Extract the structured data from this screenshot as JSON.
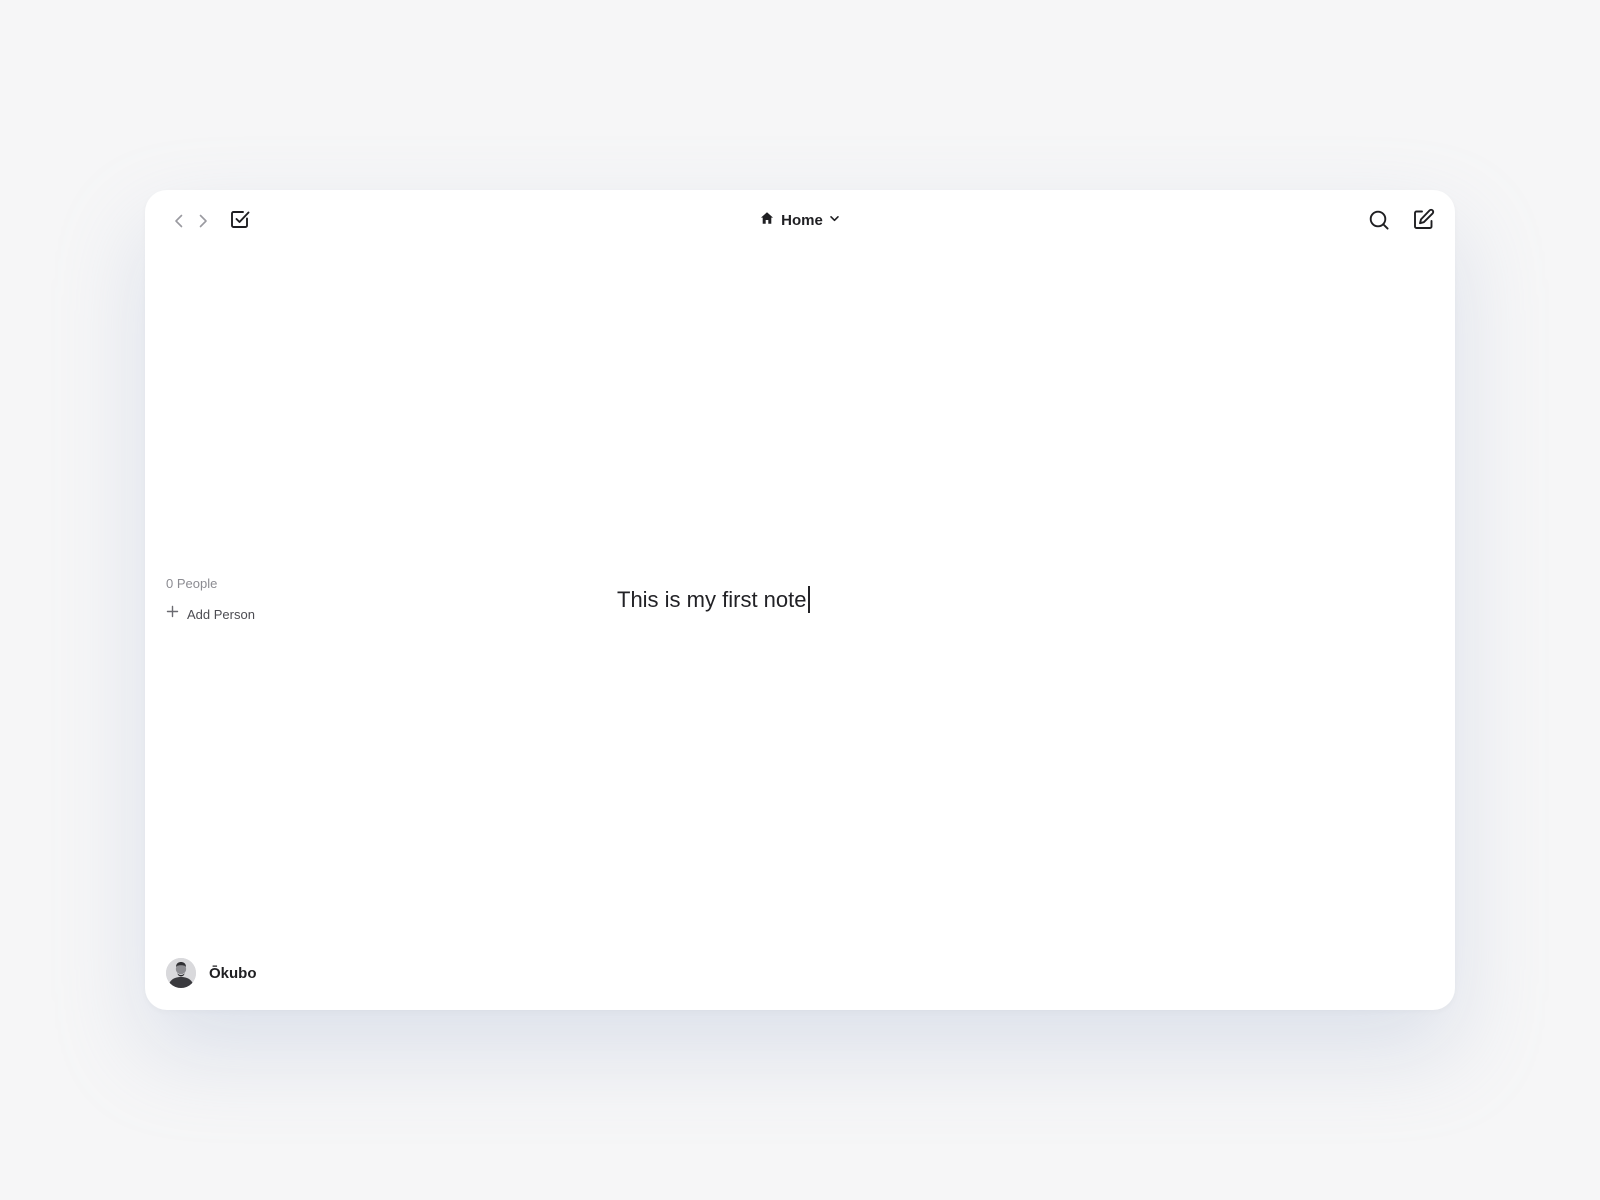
{
  "toolbar": {
    "back_icon": "chevron-left-icon",
    "forward_icon": "chevron-right-icon",
    "tasks_icon": "checkbox-icon",
    "location": {
      "icon": "home-icon",
      "label": "Home",
      "dropdown_icon": "chevron-down-icon"
    },
    "search_icon": "search-icon",
    "compose_icon": "compose-icon"
  },
  "people": {
    "count_label": "0 People",
    "add_icon": "plus-icon",
    "add_label": "Add Person"
  },
  "note": {
    "text": "This is my first note"
  },
  "user": {
    "name": "Ōkubo",
    "avatar": "avatar-photo"
  },
  "colors": {
    "background": "#f6f6f7",
    "window": "#ffffff",
    "text_primary": "#1f1f22",
    "text_muted": "#8c8c92",
    "icon_muted": "#9a9aa0"
  }
}
